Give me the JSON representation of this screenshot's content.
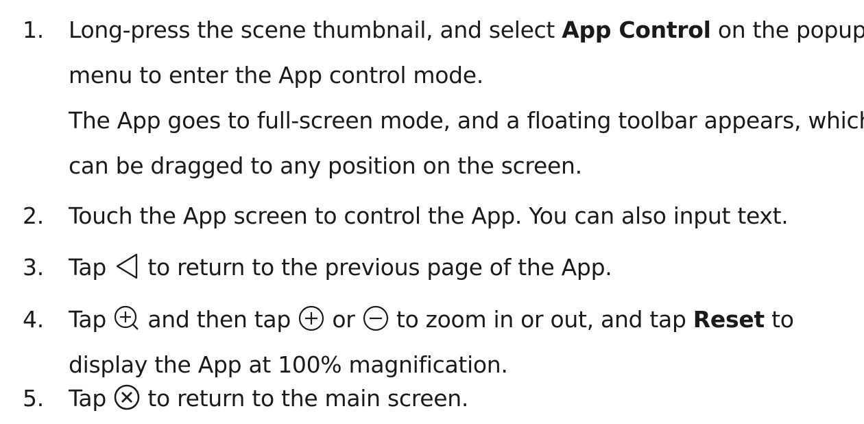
{
  "steps": [
    {
      "number": "1.",
      "line1_a": "Long-press the scene thumbnail, and select ",
      "line1_bold": "App Control",
      "line1_b": " on the popup",
      "line2": "menu to enter the App control mode.",
      "line3": "The App goes to full-screen mode, and a floating toolbar appears, which",
      "line4": "can be dragged to any position on the screen."
    },
    {
      "number": "2.",
      "text": "Touch the App screen to control the App. You can also input text."
    },
    {
      "number": "3.",
      "text_a": "Tap ",
      "icon": "back-triangle-icon",
      "text_b": " to return to the previous page of the App."
    },
    {
      "number": "4.",
      "text_a": "Tap ",
      "icon_zoom": "zoom-magnifier-plus-icon",
      "text_b": " and then tap ",
      "icon_plus": "plus-circle-icon",
      "text_c": " or ",
      "icon_minus": "minus-circle-icon",
      "text_d": " to zoom in or out, and tap ",
      "bold": "Reset",
      "text_e": " to",
      "line2": "display the App at 100% magnification."
    },
    {
      "number": "5.",
      "text_a": "Tap ",
      "icon": "close-circle-icon",
      "text_b": " to return to the main screen."
    }
  ]
}
